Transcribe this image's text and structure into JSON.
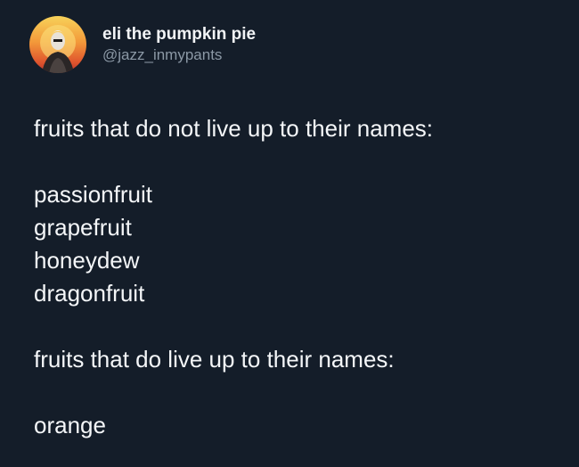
{
  "author": {
    "display_name": "eli the pumpkin pie",
    "handle": "@jazz_inmypants",
    "avatar_icon": "avatar-photo"
  },
  "tweet": {
    "heading_1": "fruits that do not live up to their names:",
    "list_1": [
      "passionfruit",
      "grapefruit",
      "honeydew",
      "dragonfruit"
    ],
    "heading_2": "fruits that do live up to their names:",
    "list_2": [
      "orange"
    ]
  },
  "colors": {
    "background": "#141d29",
    "text": "#f4f6f8",
    "handle": "#8b98a5"
  }
}
